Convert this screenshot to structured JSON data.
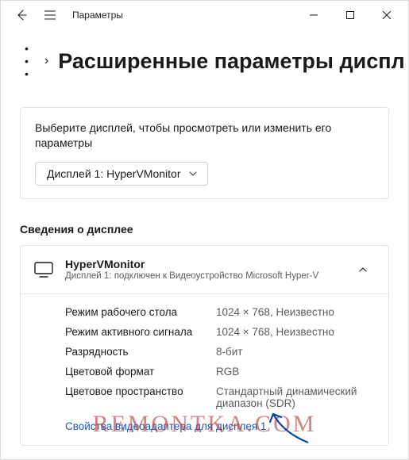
{
  "titlebar": {
    "app_title": "Параметры"
  },
  "breadcrumb": {
    "ellipsis": "•  •  •",
    "separator": "›",
    "page_title": "Расширенные параметры диспл"
  },
  "select_card": {
    "instruction": "Выберите дисплей, чтобы просмотреть или изменить его параметры",
    "dropdown_label": "Дисплей 1: HyperVMonitor"
  },
  "info_section": {
    "title": "Сведения о дисплее",
    "panel": {
      "title": "HyperVMonitor",
      "subtitle": "Дисплей 1: подключен к Видеоустройство Microsoft Hyper-V",
      "rows": [
        {
          "k": "Режим рабочего стола",
          "v": "1024 × 768, Неизвестно"
        },
        {
          "k": "Режим активного сигнала",
          "v": "1024 × 768, Неизвестно"
        },
        {
          "k": "Разрядность",
          "v": "8-бит"
        },
        {
          "k": "Цветовой формат",
          "v": "RGB"
        },
        {
          "k": "Цветовое пространство",
          "v": "Стандартный динамический диапазон (SDR)"
        }
      ],
      "link": "Свойства видеоадаптера для дисплея 1"
    }
  },
  "watermark": "REMONTKA.COM"
}
